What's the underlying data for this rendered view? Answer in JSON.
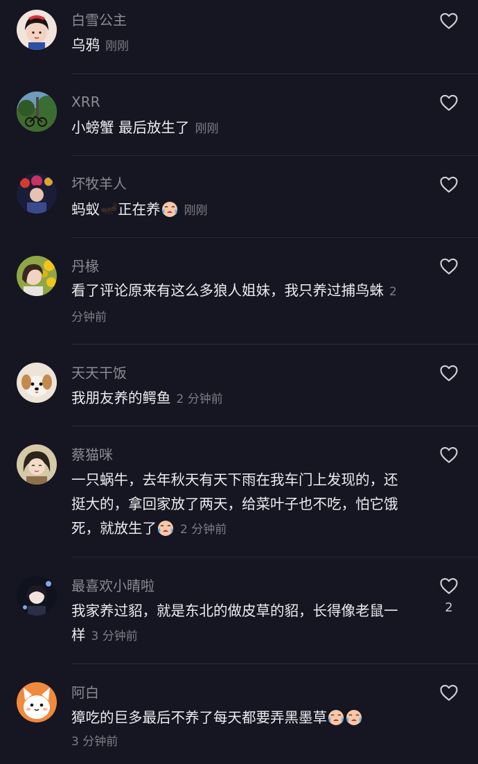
{
  "comments": [
    {
      "user": "白雪公主",
      "text": "乌鸦",
      "time": "刚刚",
      "likes": ""
    },
    {
      "user": "XRR",
      "text": "小螃蟹 最后放生了",
      "time": "刚刚",
      "likes": ""
    },
    {
      "user": "坏牧羊人",
      "text_before": "蚂蚁",
      "text_middle": "正在养",
      "time": "刚刚",
      "likes": ""
    },
    {
      "user": "丹椽",
      "text": "看了评论原来有这么多狼人姐妹，我只养过捕鸟蛛",
      "time": "2 分钟前",
      "likes": ""
    },
    {
      "user": "天天干饭",
      "text": "我朋友养的鳄鱼",
      "time": "2 分钟前",
      "likes": ""
    },
    {
      "user": "蔡猫咪",
      "text": "一只蜗牛，去年秋天有天下雨在我车门上发现的，还挺大的，拿回家放了两天，给菜叶子也不吃，怕它饿死，就放生了",
      "time": "2 分钟前",
      "likes": ""
    },
    {
      "user": "最喜欢小晴啦",
      "text": "我家养过貂，就是东北的做皮草的貂，长得像老鼠一样",
      "time": "3 分钟前",
      "likes": "2"
    },
    {
      "user": "阿白",
      "text": "獐吃的巨多最后不养了每天都要弄黑墨草",
      "time": "3 分钟前",
      "likes": ""
    }
  ],
  "icons": {
    "like": "heart-outline-icon",
    "emoji_cry": "crying-face-emoji",
    "emoji_ant": "ant-emoji"
  },
  "colors": {
    "background": "#161622",
    "username": "#8b8b94",
    "text": "#ececef",
    "time": "#7d7d86",
    "divider": "#2b2b37"
  }
}
